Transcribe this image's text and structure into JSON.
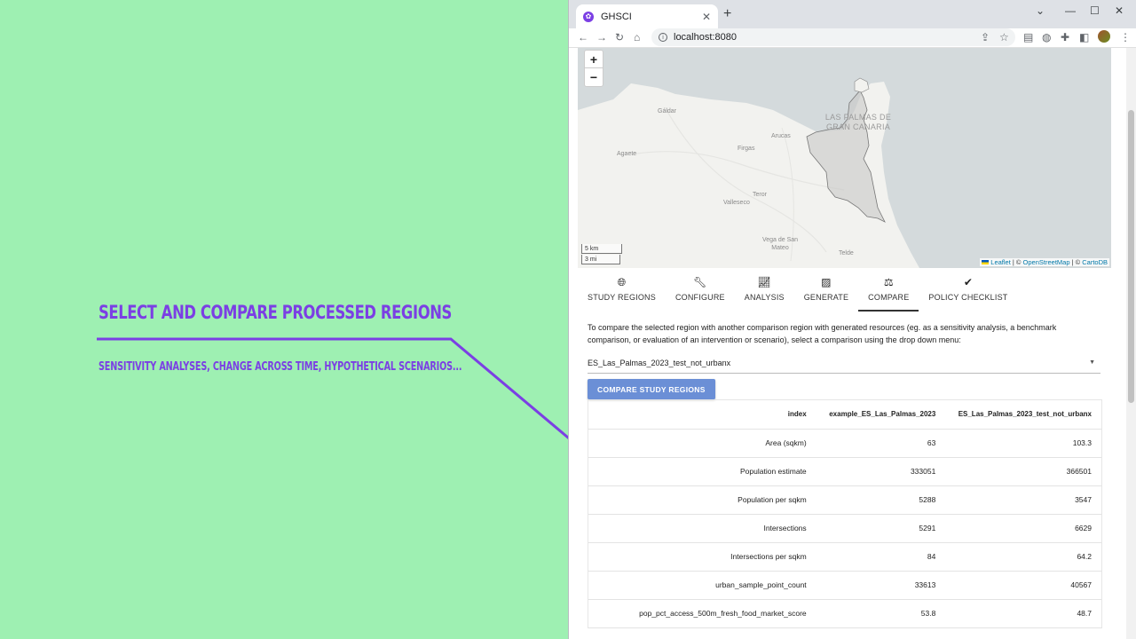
{
  "annotation": {
    "title": "SELECT AND COMPARE PROCESSED REGIONS",
    "subtitle": "SENSITIVITY ANALYSES, CHANGE ACROSS TIME, HYPOTHETICAL SCENARIOS...",
    "accent_color": "#7b3fe4"
  },
  "browser": {
    "tab_title": "GHSCI",
    "url": "localhost:8080"
  },
  "map": {
    "zoom_in": "+",
    "zoom_out": "−",
    "places": [
      "Gáldar",
      "Agaete",
      "Arucas",
      "Firgas",
      "Teror",
      "Valleseco",
      "Vega de San Mateo",
      "Telde"
    ],
    "city_label": "LAS PALMAS DE GRAN CANARIA",
    "scale_km": "5 km",
    "scale_mi": "3 mi",
    "attribution": {
      "leaflet": "Leaflet",
      "sep1": " | © ",
      "osm": "OpenStreetMap",
      "sep2": " | © ",
      "carto": "CartoDB"
    }
  },
  "nav_tabs": [
    {
      "label": "STUDY REGIONS",
      "icon": "globe-icon"
    },
    {
      "label": "CONFIGURE",
      "icon": "wrench-icon"
    },
    {
      "label": "ANALYSIS",
      "icon": "chart-icon"
    },
    {
      "label": "GENERATE",
      "icon": "images-icon"
    },
    {
      "label": "COMPARE",
      "icon": "scale-icon"
    },
    {
      "label": "POLICY CHECKLIST",
      "icon": "check-circle-icon"
    }
  ],
  "compare": {
    "description": "To compare the selected region with another comparison region with generated resources (eg. as a sensitivity analysis, a benchmark comparison, or evaluation of an intervention or scenario), select a comparison using the drop down menu:",
    "selected_value": "ES_Las_Palmas_2023_test_not_urbanx",
    "button_label": "COMPARE STUDY REGIONS"
  },
  "table": {
    "headers": [
      "index",
      "example_ES_Las_Palmas_2023",
      "ES_Las_Palmas_2023_test_not_urbanx"
    ],
    "rows": [
      [
        "Area (sqkm)",
        "63",
        "103.3"
      ],
      [
        "Population estimate",
        "333051",
        "366501"
      ],
      [
        "Population per sqkm",
        "5288",
        "3547"
      ],
      [
        "Intersections",
        "5291",
        "6629"
      ],
      [
        "Intersections per sqkm",
        "84",
        "64.2"
      ],
      [
        "urban_sample_point_count",
        "33613",
        "40567"
      ],
      [
        "pop_pct_access_500m_fresh_food_market_score",
        "53.8",
        "48.7"
      ]
    ]
  }
}
